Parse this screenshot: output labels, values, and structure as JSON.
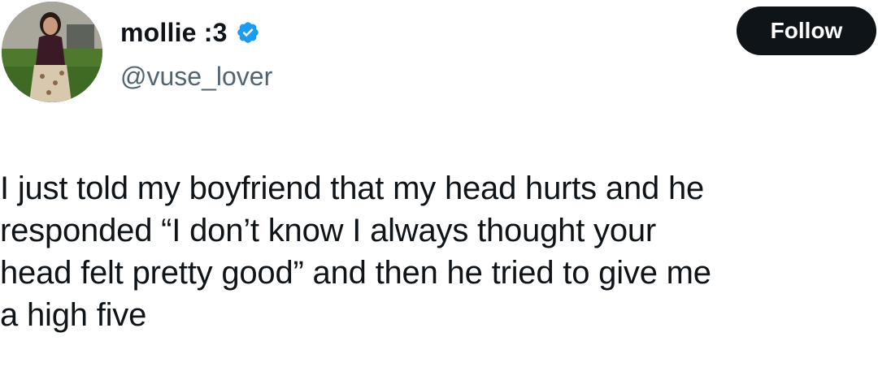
{
  "author": {
    "display_name": "mollie :3",
    "handle": "@vuse_lover",
    "verified": true,
    "avatar": "profile-photo"
  },
  "actions": {
    "follow_label": "Follow"
  },
  "tweet": {
    "text": "I just told my boyfriend that my head hurts and he\nresponded “I don’t know I always thought your\nhead felt pretty good” and then he tried to give me\na high five"
  },
  "colors": {
    "text": "#0f1419",
    "secondary_text": "#536471",
    "verified_badge": "#1d9bf0",
    "follow_button_bg": "#0f1419",
    "follow_button_text": "#ffffff"
  }
}
